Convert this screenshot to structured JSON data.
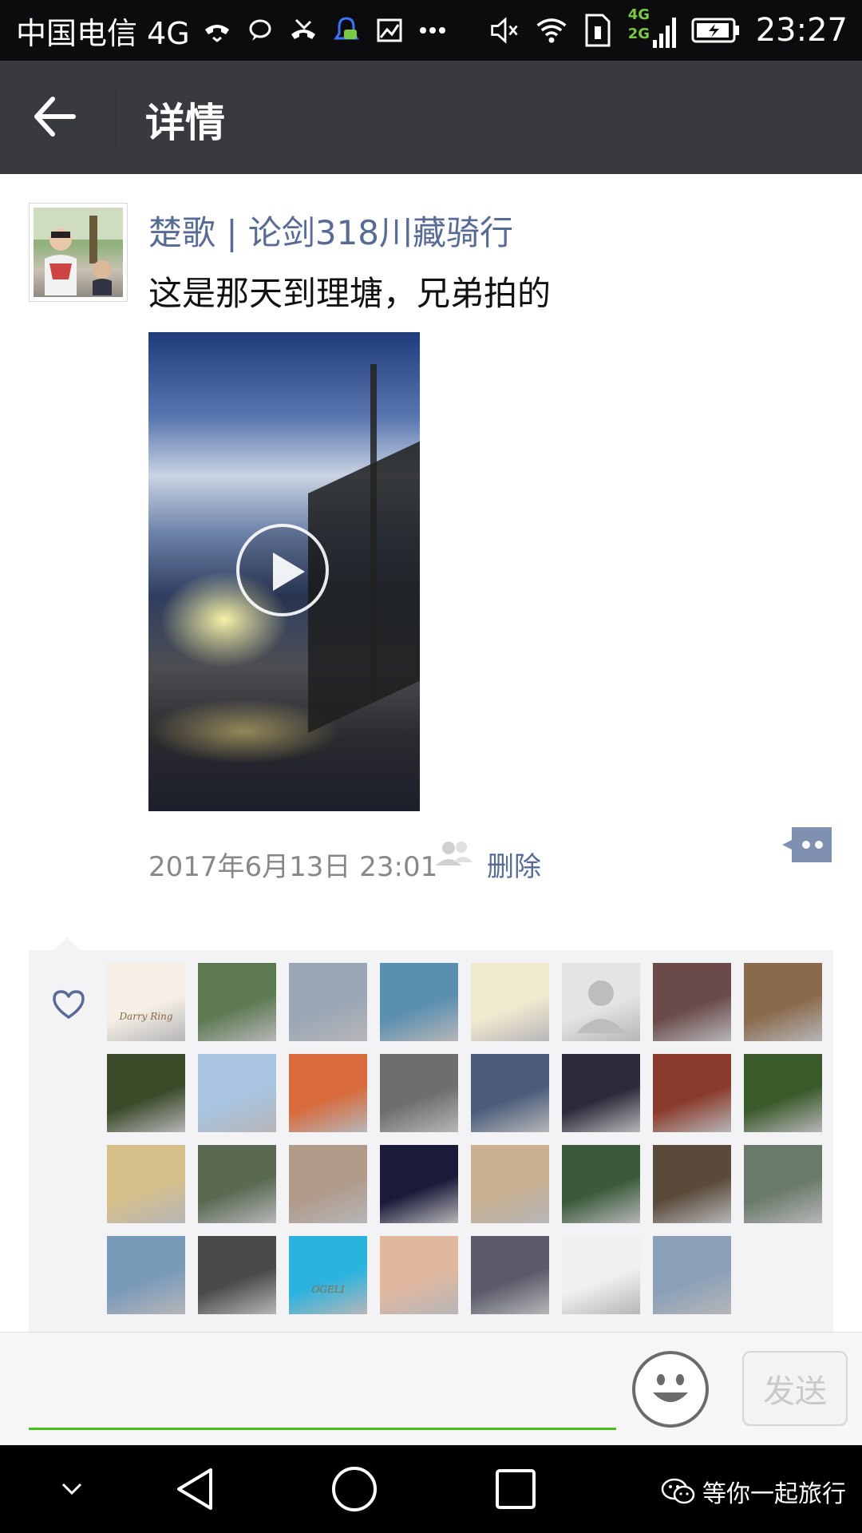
{
  "status_bar": {
    "carrier": "中国电信 4G",
    "network_labels": [
      "4G",
      "2G"
    ],
    "time": "23:27",
    "icons": [
      "missed-call-icon",
      "chat-bubble-icon",
      "missed-call-icon",
      "notification-icon",
      "image-icon",
      "more-icon",
      "mute-icon",
      "wifi-icon",
      "signal-icon",
      "battery-icon"
    ]
  },
  "header": {
    "title": "详情"
  },
  "post": {
    "author": "楚歌 | 论剑318川藏骑行",
    "text": "这是那天到理塘，兄弟拍的",
    "timestamp": "2017年6月13日 23:01",
    "delete_label": "删除",
    "media_type": "video"
  },
  "likes": {
    "icon": "heart-icon",
    "count": 31,
    "avatar_colors": [
      "#f5efe6",
      "#5d7a52",
      "#9aa6b5",
      "#5b8fb0",
      "#f2ead0",
      "#e4e4e4",
      "#6b4a4a",
      "#8a6a4c",
      "#3c4a2a",
      "#a8c4e0",
      "#d86a3c",
      "#6e6e6e",
      "#4a5c7a",
      "#2a2a3a",
      "#8a3a2a",
      "#3a5a2a",
      "#d6c08a",
      "#5a6a52",
      "#b09a8a",
      "#1a1a3a",
      "#c8b090",
      "#3a5a3a",
      "#5a4a3a",
      "#6a7a6a",
      "#7a9aba",
      "#4a4a4a",
      "#2bb3e0",
      "#e0b8a0",
      "#5a5a6a",
      "#f0f0f0",
      "#8aa0b8"
    ],
    "special": {
      "0": "Darry Ring",
      "26": "OGELI"
    }
  },
  "input": {
    "placeholder": "",
    "send_label": "发送"
  },
  "nav": {
    "watermark": "等你一起旅行"
  },
  "colors": {
    "link": "#576b95",
    "input_underline": "#45c01a",
    "title_bar": "#393a3f"
  }
}
